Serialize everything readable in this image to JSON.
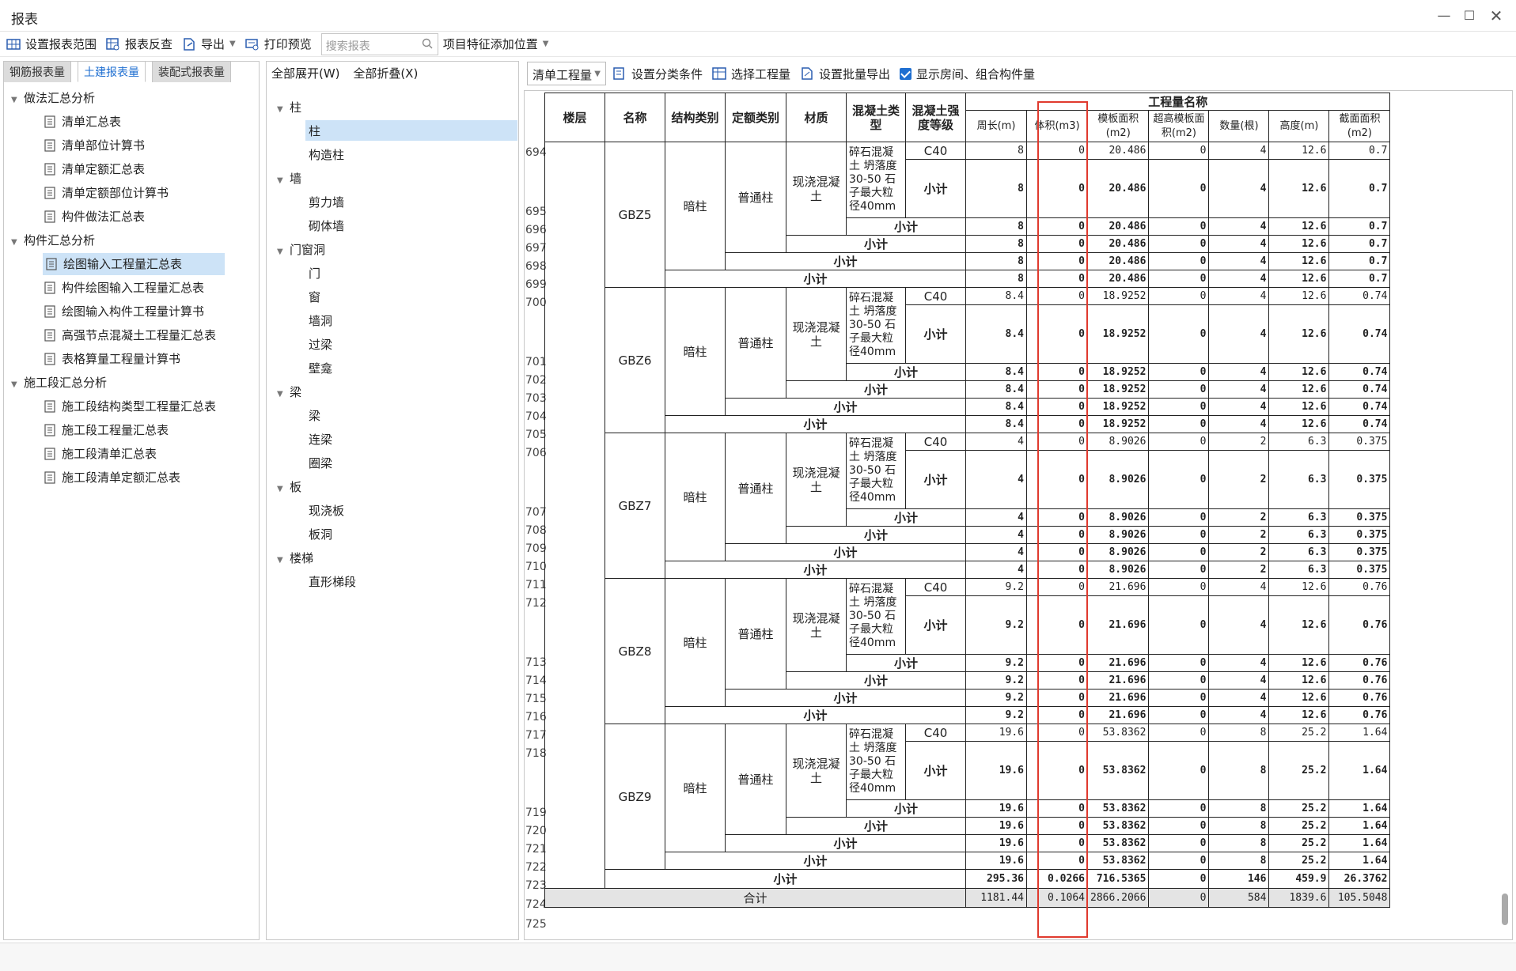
{
  "window": {
    "title": "报表"
  },
  "toolbar": {
    "set_range": "设置报表范围",
    "reverse_check": "报表反查",
    "export": "导出",
    "print_preview": "打印预览",
    "search_placeholder": "搜索报表",
    "add_feature": "项目特征添加位置"
  },
  "left_tabs": [
    "钢筋报表量",
    "土建报表量",
    "装配式报表量"
  ],
  "tree": {
    "g1": "做法汇总分析",
    "g1_items": [
      "清单汇总表",
      "清单部位计算书",
      "清单定额汇总表",
      "清单定额部位计算书",
      "构件做法汇总表"
    ],
    "g2": "构件汇总分析",
    "g2_items": [
      "绘图输入工程量汇总表",
      "构件绘图输入工程量汇总表",
      "绘图输入构件工程量计算书",
      "高强节点混凝土工程量汇总表",
      "表格算量工程量计算书"
    ],
    "g3": "施工段汇总分析",
    "g3_items": [
      "施工段结构类型工程量汇总表",
      "施工段工程量汇总表",
      "施工段清单汇总表",
      "施工段清单定额汇总表"
    ]
  },
  "mid": {
    "expand_all": "全部展开(W)",
    "collapse_all": "全部折叠(X)",
    "c1": "柱",
    "c1_items": [
      "柱",
      "构造柱"
    ],
    "c2": "墙",
    "c2_items": [
      "剪力墙",
      "砌体墙"
    ],
    "c3": "门窗洞",
    "c3_items": [
      "门",
      "窗",
      "墙洞",
      "过梁",
      "壁龛"
    ],
    "c4": "梁",
    "c4_items": [
      "梁",
      "连梁",
      "圈梁"
    ],
    "c5": "板",
    "c5_items": [
      "现浇板",
      "板洞"
    ],
    "c6": "楼梯",
    "c6_items": [
      "直形梯段"
    ]
  },
  "right_toolbar": {
    "dropdown": "清单工程量",
    "set_category": "设置分类条件",
    "select_quantity": "选择工程量",
    "batch_export": "设置批量导出",
    "show_rooms": "显示房间、组合构件量"
  },
  "report": {
    "headers": {
      "floor": "楼层",
      "name": "名称",
      "struct_type": "结构类别",
      "quota_type": "定额类别",
      "material": "材质",
      "concrete_type": "混凝土类型",
      "concrete_grade": "混凝土强度等级",
      "group": "工程量名称",
      "perimeter": "周长(m)",
      "volume": "体积(m3)",
      "formwork": "模板面积(m2)",
      "high_formwork": "超高模板面积(m2)",
      "count": "数量(根)",
      "height": "高度(m)",
      "section": "截面面积(m2)"
    },
    "struct": "暗柱",
    "quota": "普通柱",
    "material": "现浇混凝土",
    "concrete": "碎石混凝土 坍落度30-50 石子最大粒径40mm",
    "grade": "C40",
    "subtotal": "小计",
    "total": "合计",
    "groups": [
      {
        "name": "GBZ5",
        "start": 694,
        "v": [
          "8",
          "0",
          "20.486",
          "0",
          "4",
          "12.6",
          "0.7"
        ]
      },
      {
        "name": "GBZ6",
        "start": 700,
        "v": [
          "8.4",
          "0",
          "18.9252",
          "0",
          "4",
          "12.6",
          "0.74"
        ]
      },
      {
        "name": "GBZ7",
        "start": 706,
        "v": [
          "4",
          "0",
          "8.9026",
          "0",
          "2",
          "6.3",
          "0.375"
        ]
      },
      {
        "name": "GBZ8",
        "start": 712,
        "v": [
          "9.2",
          "0",
          "21.696",
          "0",
          "4",
          "12.6",
          "0.76"
        ]
      },
      {
        "name": "GBZ9",
        "start": 718,
        "v": [
          "19.6",
          "0",
          "53.8362",
          "0",
          "8",
          "25.2",
          "1.64"
        ]
      }
    ],
    "floor_subtotal": {
      "row": 724,
      "v": [
        "295.36",
        "0.0266",
        "716.5365",
        "0",
        "146",
        "459.9",
        "26.3762"
      ]
    },
    "grand_total": {
      "row": 725,
      "v": [
        "1181.44",
        "0.1064",
        "2866.2066",
        "0",
        "584",
        "1839.6",
        "105.5048"
      ]
    }
  }
}
